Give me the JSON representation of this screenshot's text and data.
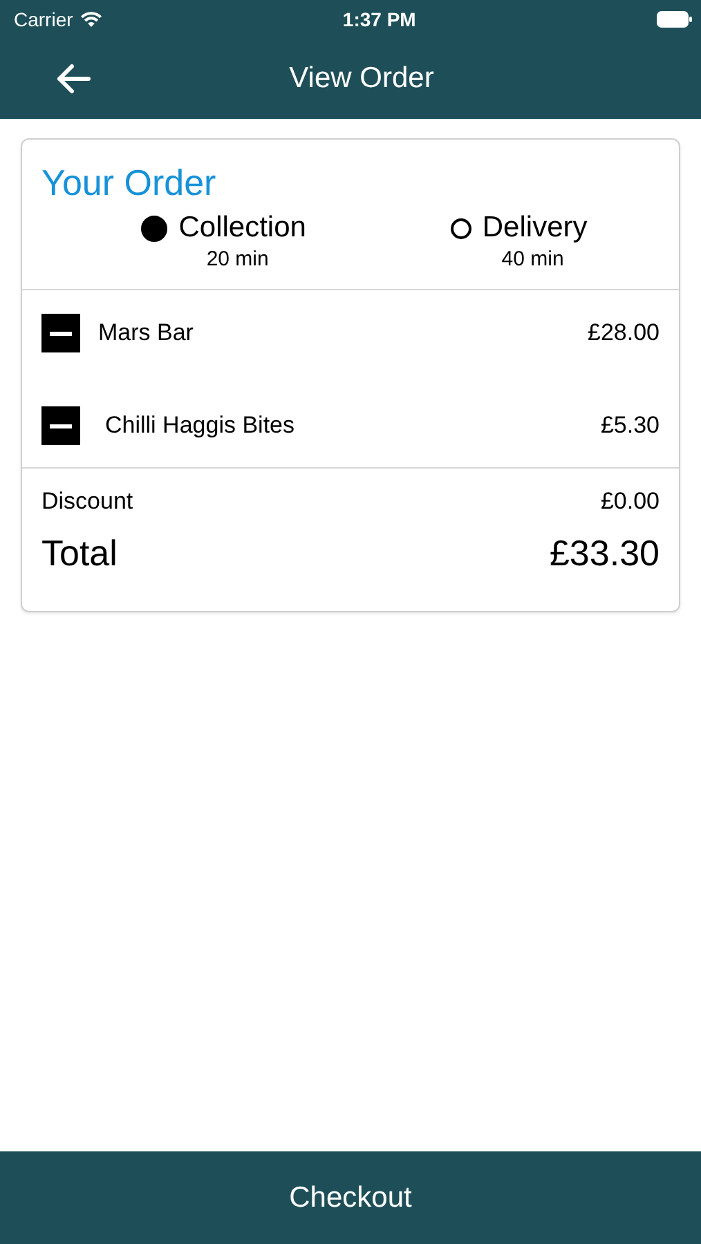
{
  "status_bar": {
    "carrier": "Carrier",
    "time": "1:37 PM"
  },
  "nav_bar": {
    "title": "View Order"
  },
  "order": {
    "title": "Your Order",
    "options": [
      {
        "label": "Collection",
        "time": "20 min",
        "selected": true
      },
      {
        "label": "Delivery",
        "time": "40 min",
        "selected": false
      }
    ],
    "items": [
      {
        "name": "Mars Bar",
        "price": "£28.00"
      },
      {
        "name": "Chilli Haggis Bites",
        "price": "£5.30"
      }
    ],
    "discount": {
      "label": "Discount",
      "value": "£0.00"
    },
    "total": {
      "label": "Total",
      "value": "£33.30"
    }
  },
  "checkout_button": "Checkout"
}
